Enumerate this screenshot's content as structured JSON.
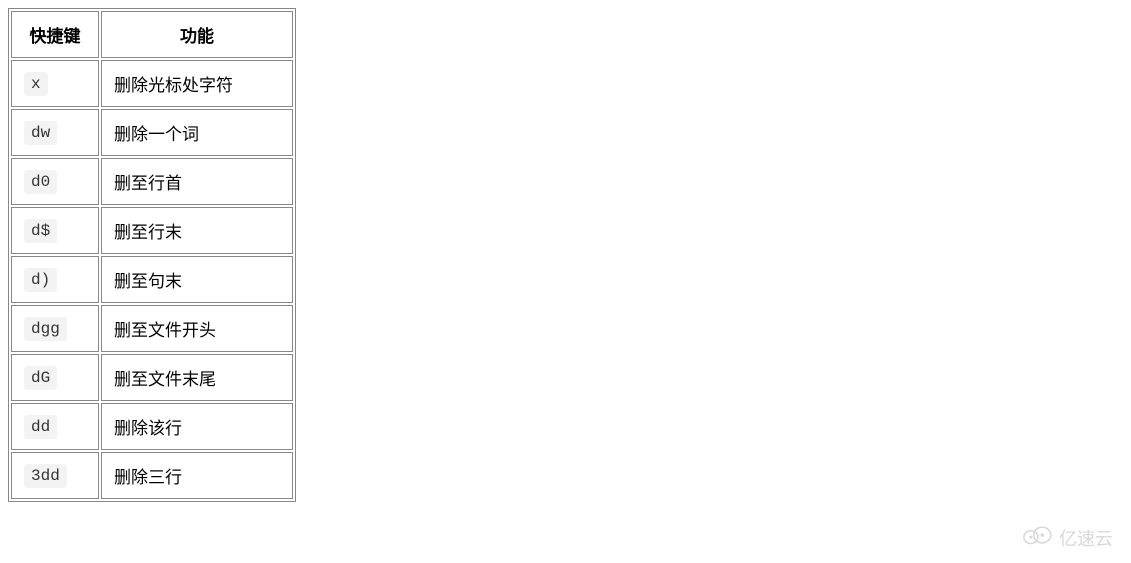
{
  "table": {
    "headers": {
      "key": "快捷键",
      "func": "功能"
    },
    "rows": [
      {
        "key": "x",
        "func": "删除光标处字符"
      },
      {
        "key": "dw",
        "func": "删除一个词"
      },
      {
        "key": "d0",
        "func": "删至行首"
      },
      {
        "key": "d$",
        "func": "删至行末"
      },
      {
        "key": "d)",
        "func": "删至句末"
      },
      {
        "key": "dgg",
        "func": "删至文件开头"
      },
      {
        "key": "dG",
        "func": "删至文件末尾"
      },
      {
        "key": "dd",
        "func": "删除该行"
      },
      {
        "key": "3dd",
        "func": "删除三行"
      }
    ]
  },
  "watermark": {
    "text": "亿速云"
  }
}
